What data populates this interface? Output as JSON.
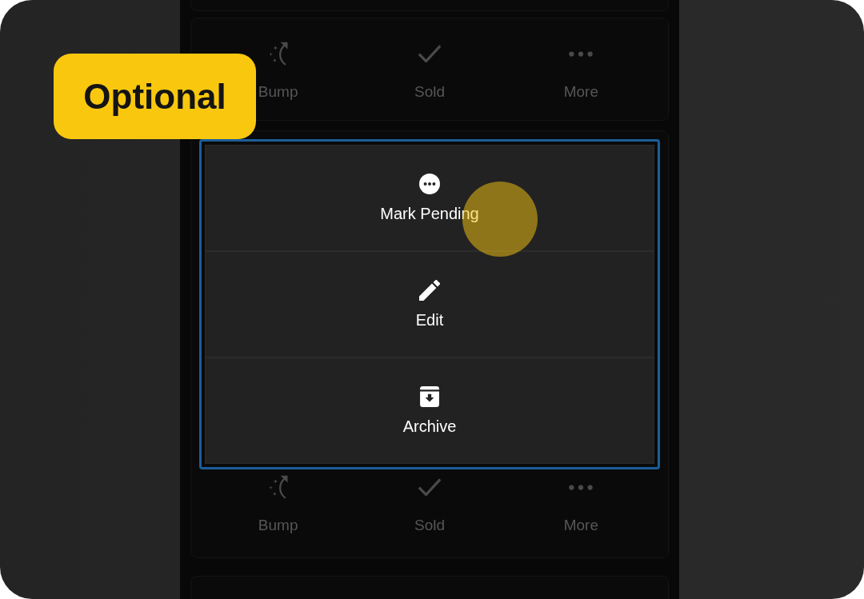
{
  "callout": {
    "label": "Optional"
  },
  "cards": [
    {
      "actions": [
        {
          "kind": "bump",
          "label": "Bump"
        },
        {
          "kind": "sold",
          "label": "Sold"
        },
        {
          "kind": "more",
          "label": "More"
        }
      ]
    },
    {
      "menu": [
        {
          "kind": "pending",
          "label": "Mark Pending"
        },
        {
          "kind": "edit",
          "label": "Edit"
        },
        {
          "kind": "archive",
          "label": "Archive"
        }
      ],
      "actions": [
        {
          "kind": "bump",
          "label": "Bump"
        },
        {
          "kind": "sold",
          "label": "Sold"
        },
        {
          "kind": "more",
          "label": "More"
        }
      ]
    }
  ]
}
